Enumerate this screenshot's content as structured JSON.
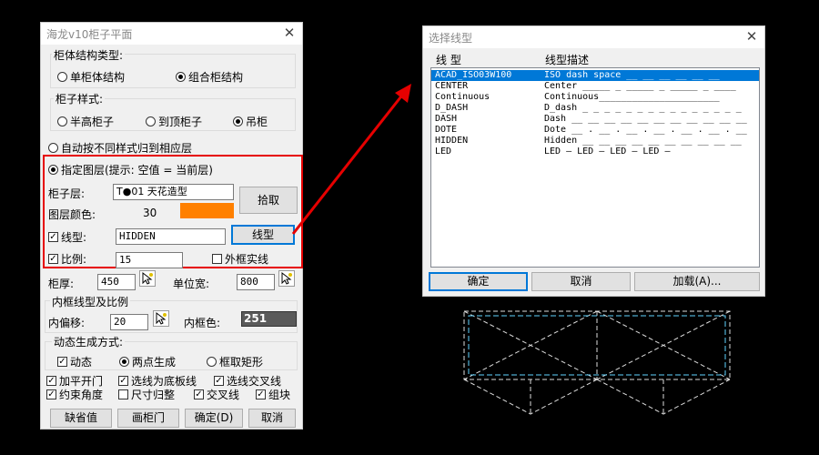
{
  "left": {
    "title": "海龙v10柜子平面",
    "close": "✕",
    "cabinet_type": {
      "label": "柜体结构类型:",
      "single": "单柜体结构",
      "combo": "组合柜结构",
      "selected": "combo"
    },
    "cabinet_style": {
      "label": "柜子样式:",
      "half": "半高柜子",
      "top": "到顶柜子",
      "hang": "吊柜",
      "selected": "hang"
    },
    "auto_layer": "自动按不同样式归到相应层",
    "assign_layer": "指定图层(提示: 空值 = 当前层)",
    "layer_label": "柜子层:",
    "layer_value": "T●01 天花造型",
    "pick_btn": "拾取",
    "color_label": "图层颜色:",
    "color_value": "30",
    "color_swatch": "#ff8000",
    "linetype_label": "线型:",
    "linetype_value": "HIDDEN",
    "linetype_btn": "线型",
    "scale_label": "比例:",
    "scale_value": "15",
    "outer_solid": "外框实线",
    "thick_label": "柜厚:",
    "thick_value": "450",
    "unit_label": "单位宽:",
    "unit_value": "800",
    "inner_group": "内框线型及比例",
    "offset_label": "内偏移:",
    "offset_value": "20",
    "inner_color_label": "内框色:",
    "inner_color_value": "251",
    "dynamic_group": "动态生成方式:",
    "dynamic": "动态",
    "two_point": "两点生成",
    "frame_rect": "框取矩形",
    "flat_door": "加平开门",
    "sel_bottom": "选线为底板线",
    "sel_cross": "选线交叉线",
    "constrain": "约束角度",
    "dim_adjust": "尺寸归整",
    "cross_line": "交叉线",
    "group": "组块",
    "btn_default": "缺省值",
    "btn_draw": "画柜门",
    "btn_ok": "确定(D)",
    "btn_cancel": "取消"
  },
  "right": {
    "title": "选择线型",
    "close": "✕",
    "col_name": "线  型",
    "col_desc": "线型描述",
    "rows": [
      {
        "name": "ACAD_ISO03W100",
        "desc": "ISO dash space __ __ __ __ __ __"
      },
      {
        "name": "CENTER",
        "desc": "Center _____ _ _____ _ _____ _ ____"
      },
      {
        "name": "Continuous",
        "desc": "Continuous______________________"
      },
      {
        "name": "D_DASH",
        "desc": "D_dash _ _ _ _ _ _ _ _ _ _ _ _ _ _ _"
      },
      {
        "name": "DASH",
        "desc": "Dash __ __ __ __ __ __ __ __ __ __ __"
      },
      {
        "name": "DOTE",
        "desc": "Dote __ . __ . __ . __ . __ . __ . __"
      },
      {
        "name": "HIDDEN",
        "desc": "Hidden __ __ __ __ __ __ __ __ __ __"
      },
      {
        "name": "LED",
        "desc": "LED — LED — LED — LED —"
      }
    ],
    "btn_ok": "确定",
    "btn_cancel": "取消",
    "btn_load": "加载(A)..."
  },
  "colors": {
    "accent_red": "#e60000",
    "selection": "#0078d7",
    "preview_line": "#5fd3ff"
  }
}
